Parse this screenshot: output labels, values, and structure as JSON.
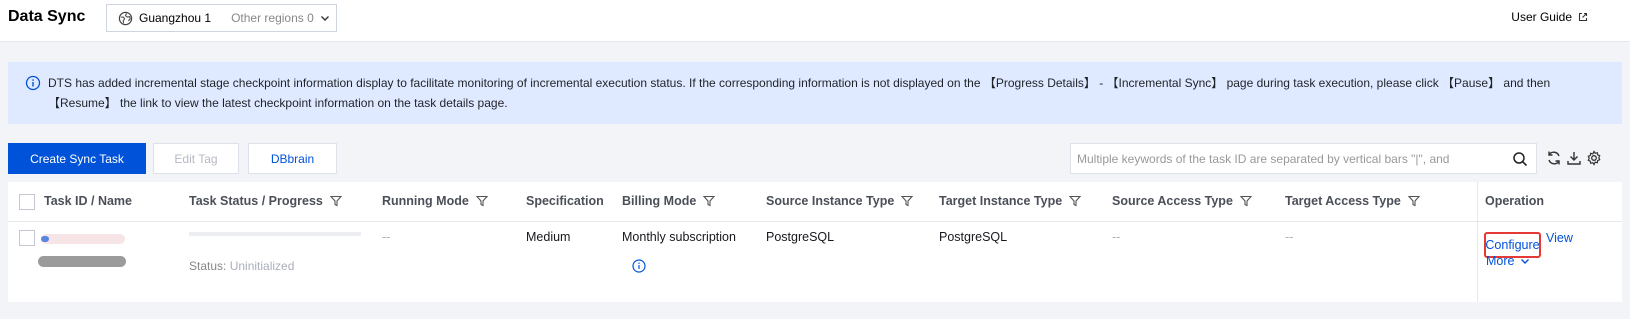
{
  "header": {
    "title": "Data Sync",
    "region": "Guangzhou 1",
    "other_regions": "Other regions 0",
    "user_guide": "User Guide"
  },
  "notice": {
    "text": "DTS has added incremental stage checkpoint information display to facilitate monitoring of incremental execution status. If the corresponding information is not displayed on the 【Progress Details】 - 【Incremental Sync】 page during task execution, please click 【Pause】 and then 【Resume】 the link to view the latest checkpoint information on the task details page."
  },
  "toolbar": {
    "create_label": "Create Sync Task",
    "edit_tag_label": "Edit Tag",
    "dbbrain_label": "DBbrain",
    "search_placeholder": "Multiple keywords of the task ID are separated by vertical bars \"|\", and"
  },
  "table": {
    "columns": [
      "Task ID / Name",
      "Task Status / Progress",
      "Running Mode",
      "Specification",
      "Billing Mode",
      "Source Instance Type",
      "Target Instance Type",
      "Source Access Type",
      "Target Access Type",
      "Operation"
    ],
    "rows": [
      {
        "status_label": "Status:",
        "status_value": "Uninitialized",
        "running_mode": "--",
        "specification": "Medium",
        "billing_mode": "Monthly subscription",
        "source_instance_type": "PostgreSQL",
        "target_instance_type": "PostgreSQL",
        "source_access_type": "--",
        "target_access_type": "--",
        "actions": {
          "configure": "Configure",
          "view": "View",
          "more": "More"
        }
      }
    ]
  },
  "colors": {
    "primary": "#0052d9",
    "notice_bg": "#dfe9ff",
    "highlight": "#e53935"
  },
  "icons": [
    "globe-icon",
    "chevron-down-icon",
    "external-link-icon",
    "info-icon",
    "search-icon",
    "refresh-icon",
    "download-icon",
    "gear-icon",
    "filter-icon"
  ]
}
